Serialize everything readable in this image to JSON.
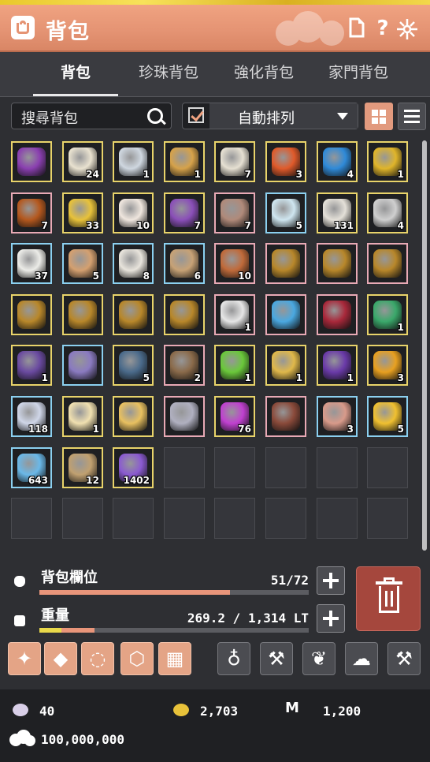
{
  "window": {
    "title": "背包"
  },
  "tabs": [
    {
      "label": "背包",
      "active": true
    },
    {
      "label": "珍珠背包",
      "active": false
    },
    {
      "label": "強化背包",
      "active": false
    },
    {
      "label": "家門背包",
      "active": false
    }
  ],
  "search": {
    "placeholder": "搜尋背包"
  },
  "sort": {
    "checked": true,
    "selected": "自動排列"
  },
  "view_mode": "grid",
  "slots": [
    {
      "qty": "",
      "border": "gold",
      "color": "#8a3fb0"
    },
    {
      "qty": "24",
      "border": "gold",
      "color": "#e9e2d0"
    },
    {
      "qty": "1",
      "border": "gold",
      "color": "#cfd7e0"
    },
    {
      "qty": "1",
      "border": "gold",
      "color": "#d6a24a"
    },
    {
      "qty": "7",
      "border": "gold",
      "color": "#e6e0d2"
    },
    {
      "qty": "3",
      "border": "gold",
      "color": "#e05a2a"
    },
    {
      "qty": "4",
      "border": "gold",
      "color": "#2f8ad8"
    },
    {
      "qty": "1",
      "border": "gold",
      "color": "#e0b52a"
    },
    {
      "qty": "7",
      "border": "pink",
      "color": "#b4581e"
    },
    {
      "qty": "33",
      "border": "gold",
      "color": "#e8c23a"
    },
    {
      "qty": "10",
      "border": "gold",
      "color": "#efe6de"
    },
    {
      "qty": "7",
      "border": "gold",
      "color": "#8a4fb8"
    },
    {
      "qty": "7",
      "border": "pink",
      "color": "#b08a7a"
    },
    {
      "qty": "5",
      "border": "blue",
      "color": "#cfe6f0"
    },
    {
      "qty": "131",
      "border": "gold",
      "color": "#e4e0d8"
    },
    {
      "qty": "4",
      "border": "gold",
      "color": "#cfcfcf"
    },
    {
      "qty": "37",
      "border": "blue",
      "color": "#ecece8"
    },
    {
      "qty": "5",
      "border": "blue",
      "color": "#d4a070"
    },
    {
      "qty": "8",
      "border": "blue",
      "color": "#e8e4dc"
    },
    {
      "qty": "6",
      "border": "blue",
      "color": "#c7a276"
    },
    {
      "qty": "10",
      "border": "pink",
      "color": "#c06a3a"
    },
    {
      "qty": "",
      "border": "pink",
      "color": "#b8872a"
    },
    {
      "qty": "",
      "border": "pink",
      "color": "#b8872a"
    },
    {
      "qty": "",
      "border": "pink",
      "color": "#b8872a"
    },
    {
      "qty": "",
      "border": "gold",
      "color": "#b8872a"
    },
    {
      "qty": "",
      "border": "gold",
      "color": "#b8872a"
    },
    {
      "qty": "",
      "border": "gold",
      "color": "#b8872a"
    },
    {
      "qty": "",
      "border": "gold",
      "color": "#b8872a"
    },
    {
      "qty": "1",
      "border": "pink",
      "color": "#e6e6e6"
    },
    {
      "qty": "",
      "border": "pink",
      "color": "#4aa8e0"
    },
    {
      "qty": "",
      "border": "pink",
      "color": "#a8283a"
    },
    {
      "qty": "1",
      "border": "gold",
      "color": "#3aa86a"
    },
    {
      "qty": "1",
      "border": "gold",
      "color": "#6a4aa0"
    },
    {
      "qty": "",
      "border": "blue",
      "color": "#8a7ac0"
    },
    {
      "qty": "5",
      "border": "gold",
      "color": "#4a6a8a"
    },
    {
      "qty": "2",
      "border": "pink",
      "color": "#8a6a4a"
    },
    {
      "qty": "1",
      "border": "gold",
      "color": "#6ac83a"
    },
    {
      "qty": "1",
      "border": "gold",
      "color": "#e0b84a"
    },
    {
      "qty": "1",
      "border": "gold",
      "color": "#6a3aa8"
    },
    {
      "qty": "3",
      "border": "gold",
      "color": "#e8a020"
    },
    {
      "qty": "118",
      "border": "blue",
      "color": "#cfd6e8"
    },
    {
      "qty": "1",
      "border": "gold",
      "color": "#f0e0b0"
    },
    {
      "qty": "",
      "border": "gold",
      "color": "#e8c060"
    },
    {
      "qty": "",
      "border": "pink",
      "color": "#b0b0c0"
    },
    {
      "qty": "76",
      "border": "gold",
      "color": "#c040d0"
    },
    {
      "qty": "",
      "border": "pink",
      "color": "#8a4a3a"
    },
    {
      "qty": "3",
      "border": "blue",
      "color": "#d89a8a"
    },
    {
      "qty": "5",
      "border": "blue",
      "color": "#f0c030"
    },
    {
      "qty": "643",
      "border": "blue",
      "color": "#6ab8e8"
    },
    {
      "qty": "12",
      "border": "gold",
      "color": "#c0a070"
    },
    {
      "qty": "1402",
      "border": "gold",
      "color": "#8a5ad0"
    }
  ],
  "total_slots": 64,
  "capacity": {
    "label": "背包欄位",
    "value": "51/72",
    "used": 51,
    "max": 72
  },
  "weight": {
    "label": "重量",
    "value": "269.2 / 1,314 LT",
    "current": 269.2,
    "max": 1314
  },
  "tools": [
    {
      "name": "enhance-wand-icon",
      "glyph": "✦",
      "style": "orange"
    },
    {
      "name": "gem-icon",
      "glyph": "◆",
      "style": "orange"
    },
    {
      "name": "moon-ring-icon",
      "glyph": "◌",
      "style": "orange"
    },
    {
      "name": "crystal-icon",
      "glyph": "⬡",
      "style": "orange"
    },
    {
      "name": "grid-dots-icon",
      "glyph": "▦",
      "style": "orange"
    },
    {
      "name": "lantern-icon",
      "glyph": "♁",
      "style": "grey"
    },
    {
      "name": "hammer-icon",
      "glyph": "⚒",
      "style": "grey"
    },
    {
      "name": "swirl-icon",
      "glyph": "❦",
      "style": "grey"
    },
    {
      "name": "anvil-icon",
      "glyph": "☁",
      "style": "grey"
    },
    {
      "name": "mallet-icon",
      "glyph": "⚒",
      "style": "grey"
    }
  ],
  "currency": {
    "pearl": "40",
    "gold": "2,703",
    "mileage": "1,200",
    "silver": "100,000,000"
  },
  "colors": {
    "accent": "#e59474",
    "danger": "#a5473d"
  }
}
